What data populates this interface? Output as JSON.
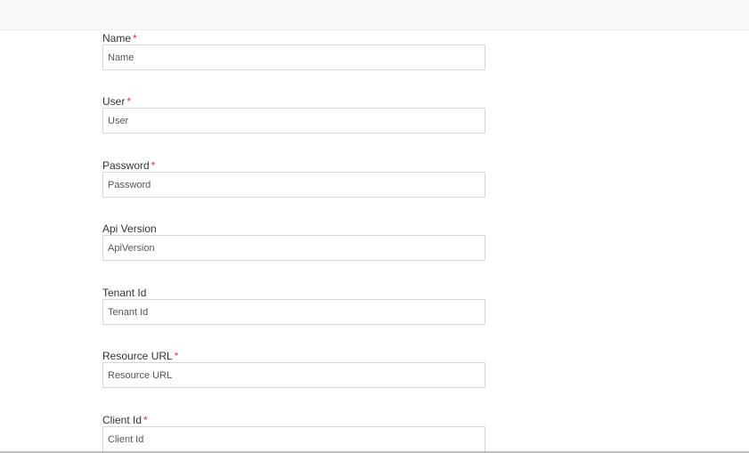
{
  "form": {
    "required_mark": "*",
    "fields": [
      {
        "label": "Name",
        "placeholder": "Name",
        "value": "",
        "required": true
      },
      {
        "label": "User",
        "placeholder": "User",
        "value": "",
        "required": true
      },
      {
        "label": "Password",
        "placeholder": "Password",
        "value": "",
        "required": true
      },
      {
        "label": "Api Version",
        "placeholder": "ApiVersion",
        "value": "",
        "required": false
      },
      {
        "label": "Tenant Id",
        "placeholder": "Tenant Id",
        "value": "",
        "required": false
      },
      {
        "label": "Resource URL",
        "placeholder": "Resource URL",
        "value": "",
        "required": true
      },
      {
        "label": "Client Id",
        "placeholder": "Client Id",
        "value": "",
        "required": true
      }
    ]
  },
  "colors": {
    "required_mark": "#e53935",
    "input_border": "#d6d6d6",
    "label_text": "#333333",
    "top_bar": "#f8f8f8"
  }
}
